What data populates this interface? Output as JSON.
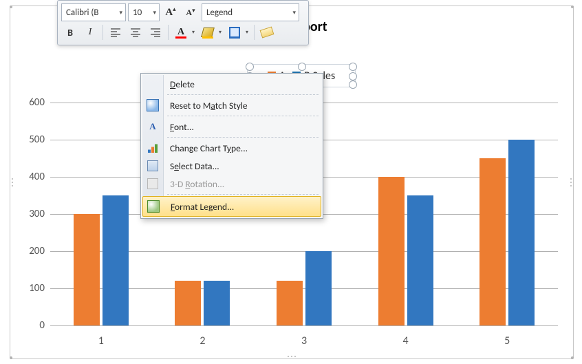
{
  "chart_data": {
    "type": "bar",
    "title": "Sales Report",
    "categories": [
      "1",
      "2",
      "3",
      "4",
      "5"
    ],
    "series": [
      {
        "name": "A",
        "color": "#ed7d31",
        "values": [
          300,
          120,
          120,
          400,
          450
        ]
      },
      {
        "name": "B Sales",
        "color": "#3277c0",
        "values": [
          350,
          120,
          200,
          350,
          500
        ]
      }
    ],
    "ylim": [
      0,
      600
    ],
    "ytick": 100,
    "xlabel": "",
    "ylabel": ""
  },
  "legend": {
    "item_a": "A",
    "item_b": "B Sales"
  },
  "mini_toolbar": {
    "font_name": "Calibri (B",
    "font_size": "10",
    "grow_font_glyph": "A",
    "shrink_font_glyph": "A",
    "placeholder_label": "Legend",
    "bold": "B",
    "italic": "I",
    "font_color_glyph": "A"
  },
  "context_menu": {
    "delete": {
      "label_pre": "",
      "mn": "D",
      "label_post": "elete"
    },
    "reset": {
      "label_pre": "Reset to M",
      "mn": "a",
      "label_post": "tch Style"
    },
    "font": {
      "label_pre": "",
      "mn": "F",
      "label_post": "ont..."
    },
    "change_type": {
      "label_pre": "Change Chart T",
      "mn": "y",
      "label_post": "pe..."
    },
    "select_data": {
      "label_pre": "S",
      "mn": "e",
      "label_post": "lect Data..."
    },
    "rotation_3d": {
      "label_pre": "3-D ",
      "mn": "R",
      "label_post": "otation..."
    },
    "format_legend": {
      "label_pre": "",
      "mn": "F",
      "label_post": "ormat Legend..."
    }
  },
  "yticks": [
    "0",
    "100",
    "200",
    "300",
    "400",
    "500",
    "600"
  ]
}
